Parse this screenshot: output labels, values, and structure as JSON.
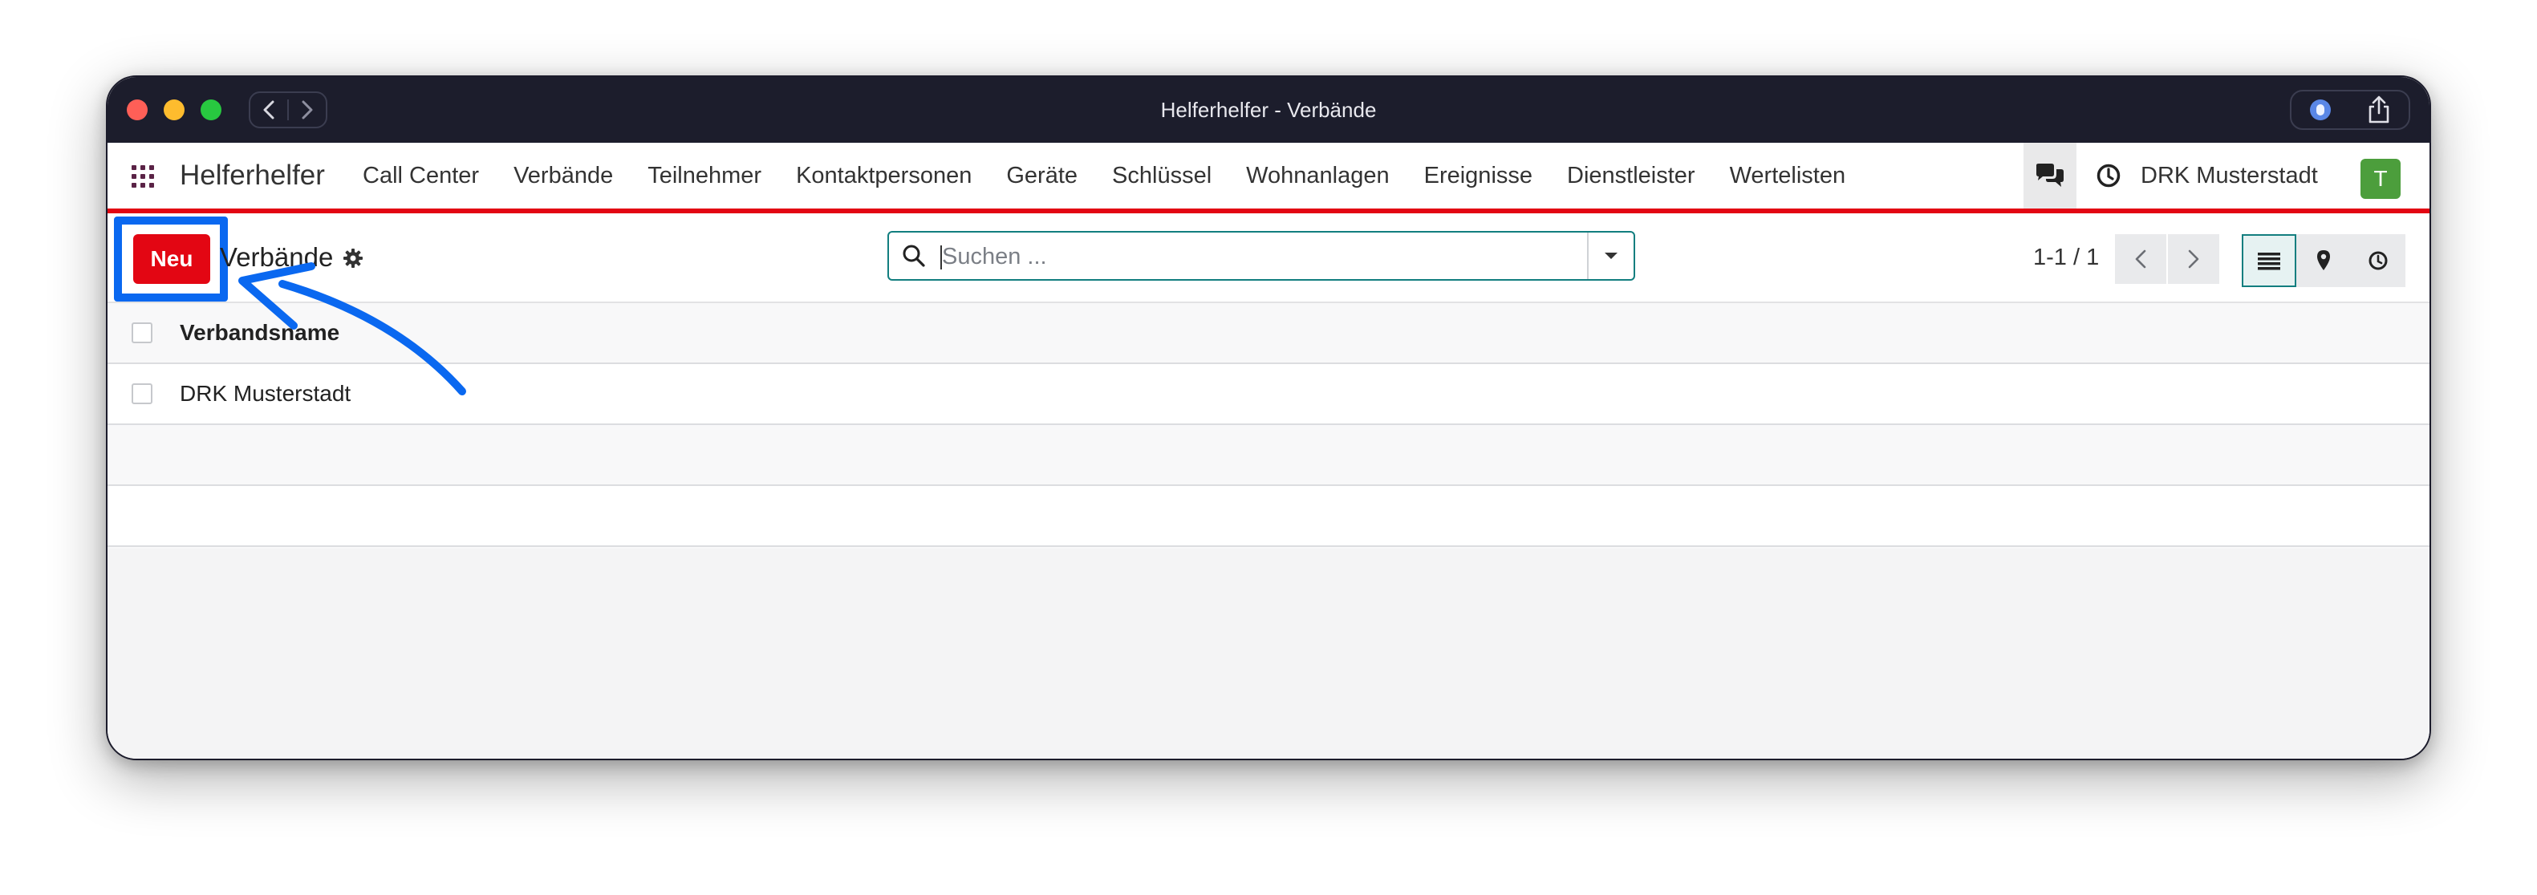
{
  "window": {
    "title": "Helferhelfer - Verbände"
  },
  "appbar": {
    "brand": "Helferhelfer",
    "menu": [
      "Call Center",
      "Verbände",
      "Teilnehmer",
      "Kontaktpersonen",
      "Geräte",
      "Schlüssel",
      "Wohnanlagen",
      "Ereignisse",
      "Dienstleister",
      "Wertelisten"
    ],
    "company": "DRK Musterstadt",
    "avatar_letter": "T",
    "accent_color": "#e30613"
  },
  "control": {
    "new_label": "Neu",
    "breadcrumb": "Verbände",
    "search_placeholder": "Suchen ...",
    "pager": "1-1 / 1"
  },
  "list": {
    "column_header": "Verbandsname",
    "rows": [
      "DRK Musterstadt"
    ]
  },
  "annotation": {
    "highlight_color": "#0a68f0"
  }
}
